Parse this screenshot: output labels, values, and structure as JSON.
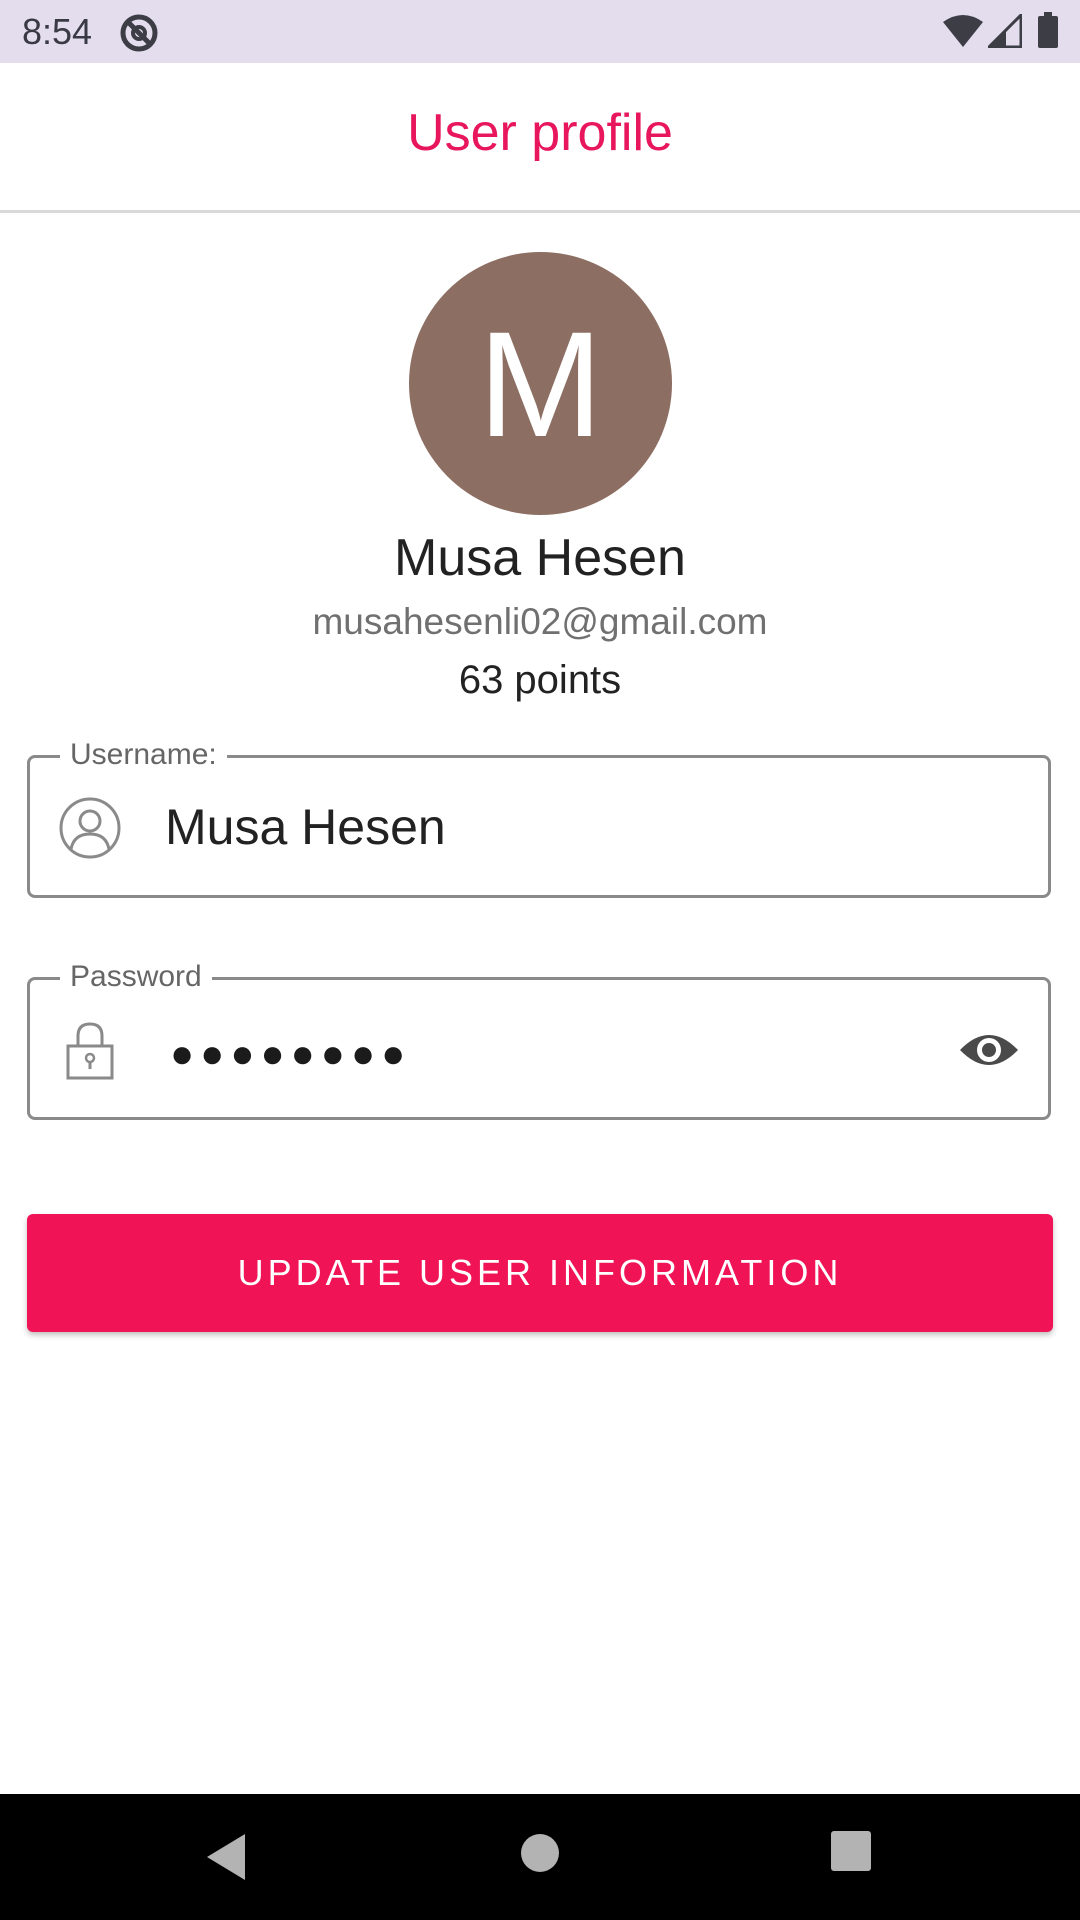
{
  "status_bar": {
    "time": "8:54",
    "icons": [
      "notification-icon",
      "wifi-icon",
      "signal-icon",
      "battery-icon"
    ]
  },
  "header": {
    "title": "User profile"
  },
  "profile": {
    "avatar_initial": "M",
    "avatar_color": "#8d6e63",
    "name": "Musa Hesen",
    "email": "musahesenli02@gmail.com",
    "points": "63 points"
  },
  "form": {
    "username": {
      "label": "Username:",
      "value": "Musa Hesen",
      "icon": "person-icon"
    },
    "password": {
      "label": "Password",
      "masked_value": "●●●●●●●●",
      "icon": "lock-icon",
      "toggle_icon": "eye-icon"
    },
    "submit_label": "UPDATE USER INFORMATION"
  },
  "colors": {
    "accent": "#e8175d",
    "button": "#f01456",
    "status_bar_bg": "#e3ddee"
  },
  "nav_bar": {
    "icons": [
      "back-icon",
      "home-icon",
      "recents-icon"
    ]
  }
}
